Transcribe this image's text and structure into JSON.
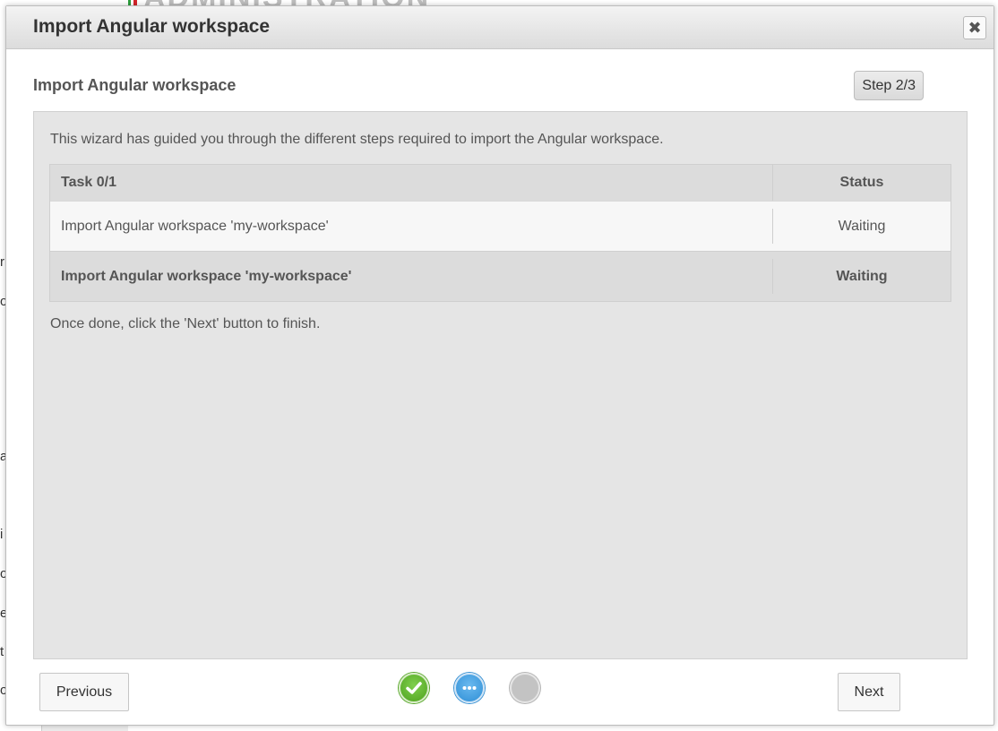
{
  "dialog": {
    "title": "Import Angular workspace",
    "close_label": "✖"
  },
  "wizard": {
    "subtitle": "Import Angular workspace",
    "step_indicator": "Step 2/3",
    "intro_text": "This wizard has guided you through the different steps required to import the Angular workspace.",
    "outro_text": "Once done, click the 'Next' button to finish.",
    "tasks_table": {
      "columns": [
        "Task 0/1",
        "Status"
      ],
      "rows": [
        {
          "task": "Import Angular workspace 'my-workspace'",
          "status": "Waiting"
        }
      ],
      "summary": {
        "task": "Import Angular workspace 'my-workspace'",
        "status": "Waiting"
      }
    }
  },
  "footer": {
    "previous_label": "Previous",
    "next_label": "Next",
    "steps": [
      {
        "state": "done",
        "icon": "check-icon",
        "color": "#4fa21f"
      },
      {
        "state": "current",
        "icon": "ellipsis-icon",
        "color": "#2f8fd6"
      },
      {
        "state": "pending",
        "icon": "circle-icon",
        "color": "#c3c3c3"
      }
    ]
  },
  "background": {
    "edge_letters": [
      "r",
      "o",
      "a",
      "i",
      "o",
      "e",
      "t",
      "o"
    ]
  }
}
